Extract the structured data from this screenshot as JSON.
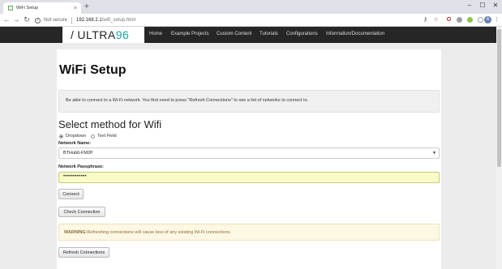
{
  "browser": {
    "tab_title": "WiFi Setup",
    "tab_close": "×",
    "new_tab": "+",
    "security_label": "Not secure",
    "url_host": "192.168.2.1",
    "url_path": "/wifi_setup.html",
    "avatar_letter": "A",
    "window_controls": [
      "–",
      "☐",
      "✕"
    ]
  },
  "site": {
    "logo_prefix": "/",
    "logo_main": "ULTRA",
    "logo_accent": "96",
    "nav": [
      "Home",
      "Example Projects",
      "Custom Content",
      "Tutorials",
      "Configurations",
      "Information/Documentation"
    ]
  },
  "page": {
    "title": "WiFi Setup",
    "info_text": "Be able to connect to a Wi-Fi network. You first need to press \"Refresh Connections\" to see a list of networks to connect to.",
    "section_title": "Select method for Wifi",
    "radio_dropdown": "Dropdown",
    "radio_text_field": "Text Field",
    "network_name_label": "Network Name:",
    "network_name_value": "BTHub6-FM2P",
    "passphrase_label": "Network Passphrase:",
    "passphrase_value": "••••••••••••",
    "connect_button": "Connect",
    "check_button": "Check Connection",
    "warning_strong": "WARNING:",
    "warning_text": "Refreshing connections will cause loss of any existing Wi-Fi connections.",
    "refresh_button": "Refresh Connections"
  }
}
